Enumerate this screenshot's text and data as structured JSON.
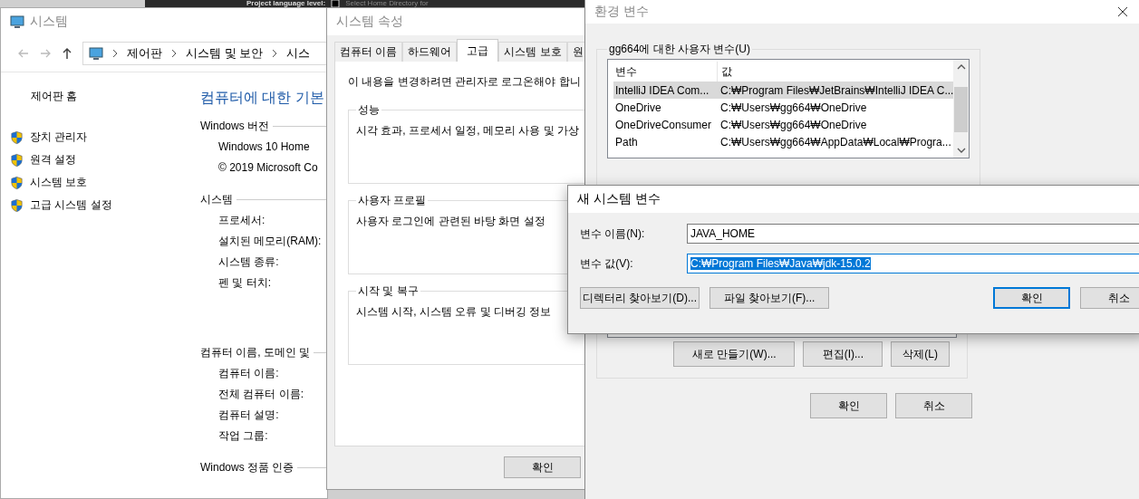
{
  "background_window": {
    "texts": [
      "Project language level:",
      "Select Home Directory for"
    ]
  },
  "system_window": {
    "title": "시스템",
    "active": false,
    "breadcrumb": [
      "제어판",
      "시스템 및 보안",
      "시스"
    ],
    "sidebar": {
      "home": "제어판 홈",
      "items": [
        "장치 관리자",
        "원격 설정",
        "시스템 보호",
        "고급 시스템 설정"
      ]
    },
    "heading": "컴퓨터에 대한 기본",
    "sections": [
      {
        "title": "Windows 버전",
        "rows": [
          "Windows 10 Home",
          "© 2019 Microsoft Co"
        ]
      },
      {
        "title": "시스템",
        "rows": [
          "프로세서:",
          "설치된 메모리(RAM):",
          "시스템 종류:",
          "펜 및 터치:"
        ]
      },
      {
        "title": "컴퓨터 이름, 도메인 및",
        "rows": [
          "컴퓨터 이름:",
          "전체 컴퓨터 이름:",
          "컴퓨터 설명:",
          "작업 그룹:"
        ]
      },
      {
        "title": "Windows 정품 인증"
      }
    ]
  },
  "system_properties": {
    "title": "시스템 속성",
    "active": false,
    "tabs": [
      {
        "label": "컴퓨터 이름",
        "selected": false
      },
      {
        "label": "하드웨어",
        "selected": false
      },
      {
        "label": "고급",
        "selected": true
      },
      {
        "label": "시스템 보호",
        "selected": false
      },
      {
        "label": "원",
        "selected": false
      }
    ],
    "notice": "이 내용을 변경하려면 관리자로 로그온해야 합니",
    "groups": [
      {
        "title": "성능",
        "description": "시각 효과, 프로세서 일정, 메모리 사용 및 가상"
      },
      {
        "title": "사용자 프로필",
        "description": "사용자 로그인에 관련된 바탕 화면 설정"
      },
      {
        "title": "시작 및 복구",
        "description": "시스템 시작, 시스템 오류 및 디버깅 정보"
      }
    ],
    "buttons": [
      "확인"
    ]
  },
  "environment_variables": {
    "title": "환경 변수",
    "active": false,
    "user_variables": {
      "title": "gg664에 대한 사용자 변수(U)",
      "columns": [
        "변수",
        "값"
      ],
      "rows": [
        {
          "name": "IntelliJ IDEA Com...",
          "value": "C:₩Program Files₩JetBrains₩IntelliJ IDEA C...",
          "selected": true
        },
        {
          "name": "OneDrive",
          "value": "C:₩Users₩gg664₩OneDrive",
          "selected": false
        },
        {
          "name": "OneDriveConsumer",
          "value": "C:₩Users₩gg664₩OneDrive",
          "selected": false
        },
        {
          "name": "Path",
          "value": "C:₩Users₩gg664₩AppData₩Local₩Progra...",
          "selected": false
        }
      ]
    },
    "system_variable_buttons": [
      "새로 만들기(W)...",
      "편집(I)...",
      "삭제(L)"
    ],
    "buttons": [
      "확인",
      "취소"
    ]
  },
  "new_system_variable": {
    "title": "새 시스템 변수",
    "active": true,
    "fields": [
      {
        "label": "변수 이름(N):",
        "value": "JAVA_HOME",
        "focused": false
      },
      {
        "label": "변수 값(V):",
        "value": "C:₩Program Files₩Java₩jdk-15.0.2",
        "focused": true
      }
    ],
    "browse_buttons": [
      "디렉터리 찾아보기(D)...",
      "파일 찾아보기(F)..."
    ],
    "buttons": [
      {
        "label": "확인",
        "default": true
      },
      {
        "label": "취소",
        "default": false
      }
    ]
  }
}
